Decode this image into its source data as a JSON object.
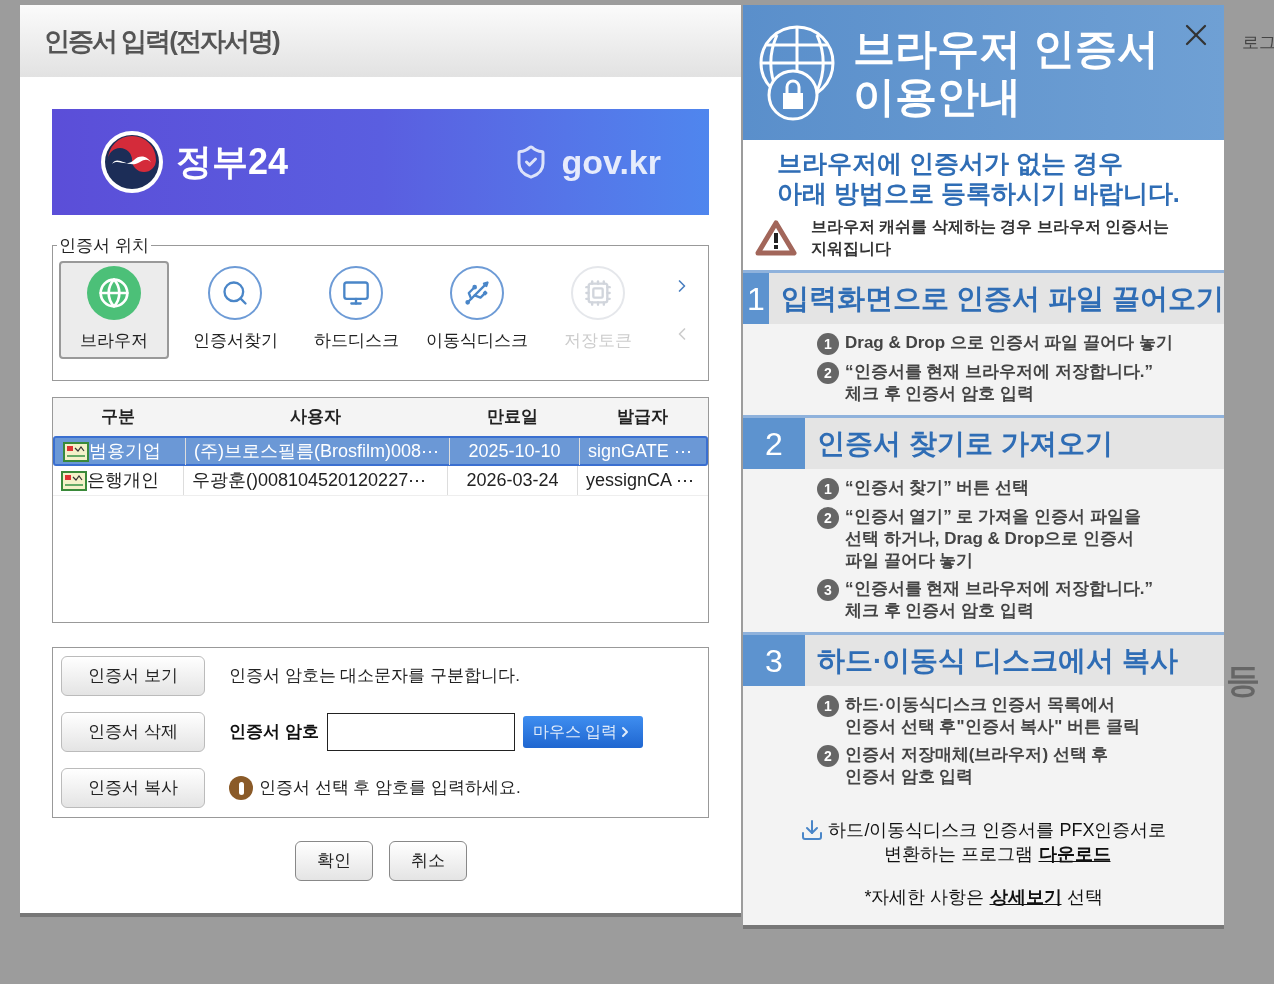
{
  "background": {
    "fragments": [
      {
        "kind": "top-right",
        "text": "로그"
      },
      {
        "kind": "right",
        "text": "등"
      }
    ]
  },
  "dialog": {
    "title": "인증서 입력(전자서명)",
    "banner": {
      "brand": "정부24",
      "domain": "gov.kr"
    },
    "location": {
      "legend": "인증서 위치",
      "items": [
        {
          "kind": "browser",
          "label": "브라우저",
          "selected": true,
          "disabled": false
        },
        {
          "kind": "search",
          "label": "인증서찾기",
          "selected": false,
          "disabled": false
        },
        {
          "kind": "harddisk",
          "label": "하드디스크",
          "selected": false,
          "disabled": false
        },
        {
          "kind": "usb",
          "label": "이동식디스크",
          "selected": false,
          "disabled": false
        },
        {
          "kind": "token",
          "label": "저장토큰",
          "selected": false,
          "disabled": true
        }
      ]
    },
    "table": {
      "columns": [
        "구분",
        "사용자",
        "만료일",
        "발급자"
      ],
      "rows": [
        {
          "selected": true,
          "cells": [
            "범용기업",
            "(주)브로스필름(Brosfilm)008⋯",
            "2025-10-10",
            "signGATE ⋯"
          ]
        },
        {
          "selected": false,
          "cells": [
            "은행개인",
            "우광훈()008104520120227⋯",
            "2026-03-24",
            "yessignCA ⋯"
          ]
        }
      ]
    },
    "actions": [
      "인증서 보기",
      "인증서 삭제",
      "인증서 복사"
    ],
    "case_note": "인증서 암호는 대소문자를 구분합니다.",
    "password_label": "인증서 암호",
    "mouse_input": "마우스 입력",
    "hint": "인증서 선택 후 암호를 입력하세요.",
    "buttons": [
      "확인",
      "취소"
    ]
  },
  "guide": {
    "title_lines": [
      "브라우저 인증서",
      "이용안내"
    ],
    "subtitle_lines": [
      "브라우저에 인증서가 없는 경우",
      "아래 방법으로 등록하시기 바랍니다."
    ],
    "warning_lines": [
      "브라우저 캐쉬를 삭제하는 경우 브라우저 인증서는",
      "지워집니다"
    ],
    "sections": [
      {
        "number": "1",
        "title": "입력화면으로 인증서 파일 끌어오기",
        "steps": [
          {
            "number": "1",
            "lines": [
              "Drag & Drop 으로 인증서 파일 끌어다 놓기"
            ]
          },
          {
            "number": "2",
            "lines": [
              "“인증서를 현재 브라우저에 저장합니다.”",
              "체크 후 인증서 암호 입력"
            ]
          }
        ]
      },
      {
        "number": "2",
        "title": "인증서 찾기로 가져오기",
        "steps": [
          {
            "number": "1",
            "lines": [
              "“인증서 찾기” 버튼 선택"
            ]
          },
          {
            "number": "2",
            "lines": [
              "“인증서 열기” 로 가져올 인증서 파일을",
              "선택 하거나, Drag & Drop으로 인증서",
              "파일 끌어다 놓기"
            ]
          },
          {
            "number": "3",
            "lines": [
              "“인증서를 현재 브라우저에 저장합니다.”",
              "체크 후 인증서 암호 입력"
            ]
          }
        ]
      },
      {
        "number": "3",
        "title": "하드·이동식 디스크에서 복사",
        "steps": [
          {
            "number": "1",
            "lines": [
              "하드·이동식디스크 인증서 목록에서",
              "인증서 선택 후\"인증서 복사\" 버튼 클릭"
            ]
          },
          {
            "number": "2",
            "lines": [
              "인증서 저장매체(브라우저) 선택 후",
              "인증서 암호 입력"
            ]
          }
        ]
      }
    ],
    "download": {
      "line1": "하드/이동식디스크 인증서를 PFX인증서로",
      "line2": "변환하는 프로그램",
      "link": "다운로드"
    },
    "detail": {
      "before": "*자세한 사항은",
      "link": "상세보기",
      "after": "선택"
    }
  }
}
